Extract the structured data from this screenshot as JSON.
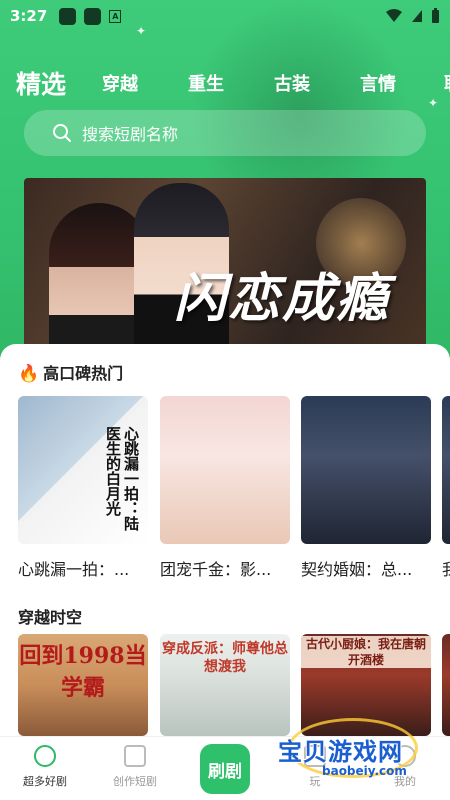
{
  "status_bar": {
    "time": "3:27",
    "a_glyph": "A"
  },
  "tabs": [
    {
      "label": "精选",
      "active": true
    },
    {
      "label": "穿越",
      "active": false
    },
    {
      "label": "重生",
      "active": false
    },
    {
      "label": "古装",
      "active": false
    },
    {
      "label": "言情",
      "active": false
    },
    {
      "label": "职",
      "active": false
    }
  ],
  "search": {
    "placeholder": "搜索短剧名称"
  },
  "banner": {
    "title": "闪恋成瘾"
  },
  "sections": [
    {
      "title": "高口碑热门",
      "icon": "fire-icon",
      "cards": [
        {
          "title": "心跳漏一拍：...",
          "cover_text": "心跳漏一拍：陆医生的白月光"
        },
        {
          "title": "团宠千金：影...",
          "cover_text": ""
        },
        {
          "title": "契约婚姻：总...",
          "cover_text": ""
        },
        {
          "title": "我",
          "cover_text": ""
        }
      ]
    },
    {
      "title": "穿越时空",
      "icon": "",
      "cards": [
        {
          "title": "",
          "cover_text": "回到1998当学霸"
        },
        {
          "title": "",
          "cover_text": "穿成反派：师尊他总想渡我"
        },
        {
          "title": "",
          "cover_text": "古代小厨娘：我在唐朝开酒楼"
        }
      ]
    }
  ],
  "bottom_nav": {
    "items": [
      {
        "label": "超多好剧",
        "active": true,
        "icon": "star-home-icon"
      },
      {
        "label": "创作短剧",
        "active": false,
        "icon": "plus-square-icon"
      },
      {
        "label": "玩",
        "active": false,
        "icon": "game-icon"
      },
      {
        "label": "我的",
        "active": false,
        "icon": "user-icon"
      }
    ],
    "center_label": "刷剧"
  },
  "watermark": {
    "text": "宝贝游戏网",
    "url": "baobeiy.com"
  },
  "colors": {
    "accent": "#2fc06b",
    "header_bg": "#3ecb7a"
  }
}
